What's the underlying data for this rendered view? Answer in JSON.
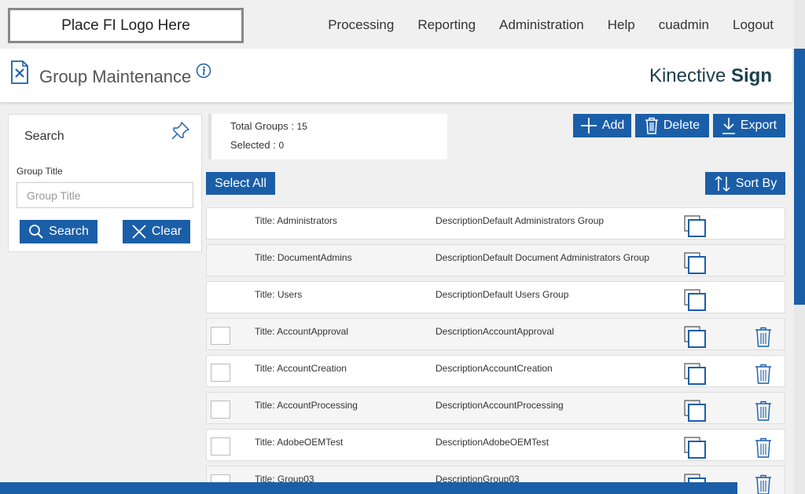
{
  "header": {
    "logo_text": "Place FI Logo Here",
    "nav": [
      "Processing",
      "Reporting",
      "Administration",
      "Help",
      "cuadmin",
      "Logout"
    ]
  },
  "title_bar": {
    "page_title": "Group Maintenance",
    "brand_light": "Kinective",
    "brand_bold": "Sign"
  },
  "search": {
    "heading": "Search",
    "group_title_label": "Group Title",
    "group_title_placeholder": "Group Title",
    "group_title_value": "",
    "search_label": "Search",
    "clear_label": "Clear"
  },
  "stats": {
    "total_label": "Total Groups : ",
    "total_value": "15",
    "selected_label": "Selected : ",
    "selected_value": "0"
  },
  "toolbar": {
    "add_label": "Add",
    "delete_label": "Delete",
    "export_label": "Export",
    "select_all_label": "Select All",
    "sort_by_label": "Sort By"
  },
  "colors": {
    "accent": "#1b5ea8",
    "brand_text": "#1a3f4c"
  },
  "groups": [
    {
      "title": "Title: Administrators",
      "desc_label": "Description",
      "desc": "Default Administrators Group",
      "checkbox": false,
      "deletable": false
    },
    {
      "title": "Title: DocumentAdmins",
      "desc_label": "Description",
      "desc": "Default Document Administrators Group",
      "checkbox": false,
      "deletable": false
    },
    {
      "title": "Title: Users",
      "desc_label": "Description",
      "desc": "Default Users Group",
      "checkbox": false,
      "deletable": false
    },
    {
      "title": "Title: AccountApproval",
      "desc_label": "Description",
      "desc": "AccountApproval",
      "checkbox": true,
      "deletable": true
    },
    {
      "title": "Title: AccountCreation",
      "desc_label": "Description",
      "desc": "AccountCreation",
      "checkbox": true,
      "deletable": true
    },
    {
      "title": "Title: AccountProcessing",
      "desc_label": "Description",
      "desc": "AccountProcessing",
      "checkbox": true,
      "deletable": true
    },
    {
      "title": "Title: AdobeOEMTest",
      "desc_label": "Description",
      "desc": "AdobeOEMTest",
      "checkbox": true,
      "deletable": true
    },
    {
      "title": "Title: Group03",
      "desc_label": "Description",
      "desc": "Group03",
      "checkbox": true,
      "deletable": true
    }
  ]
}
